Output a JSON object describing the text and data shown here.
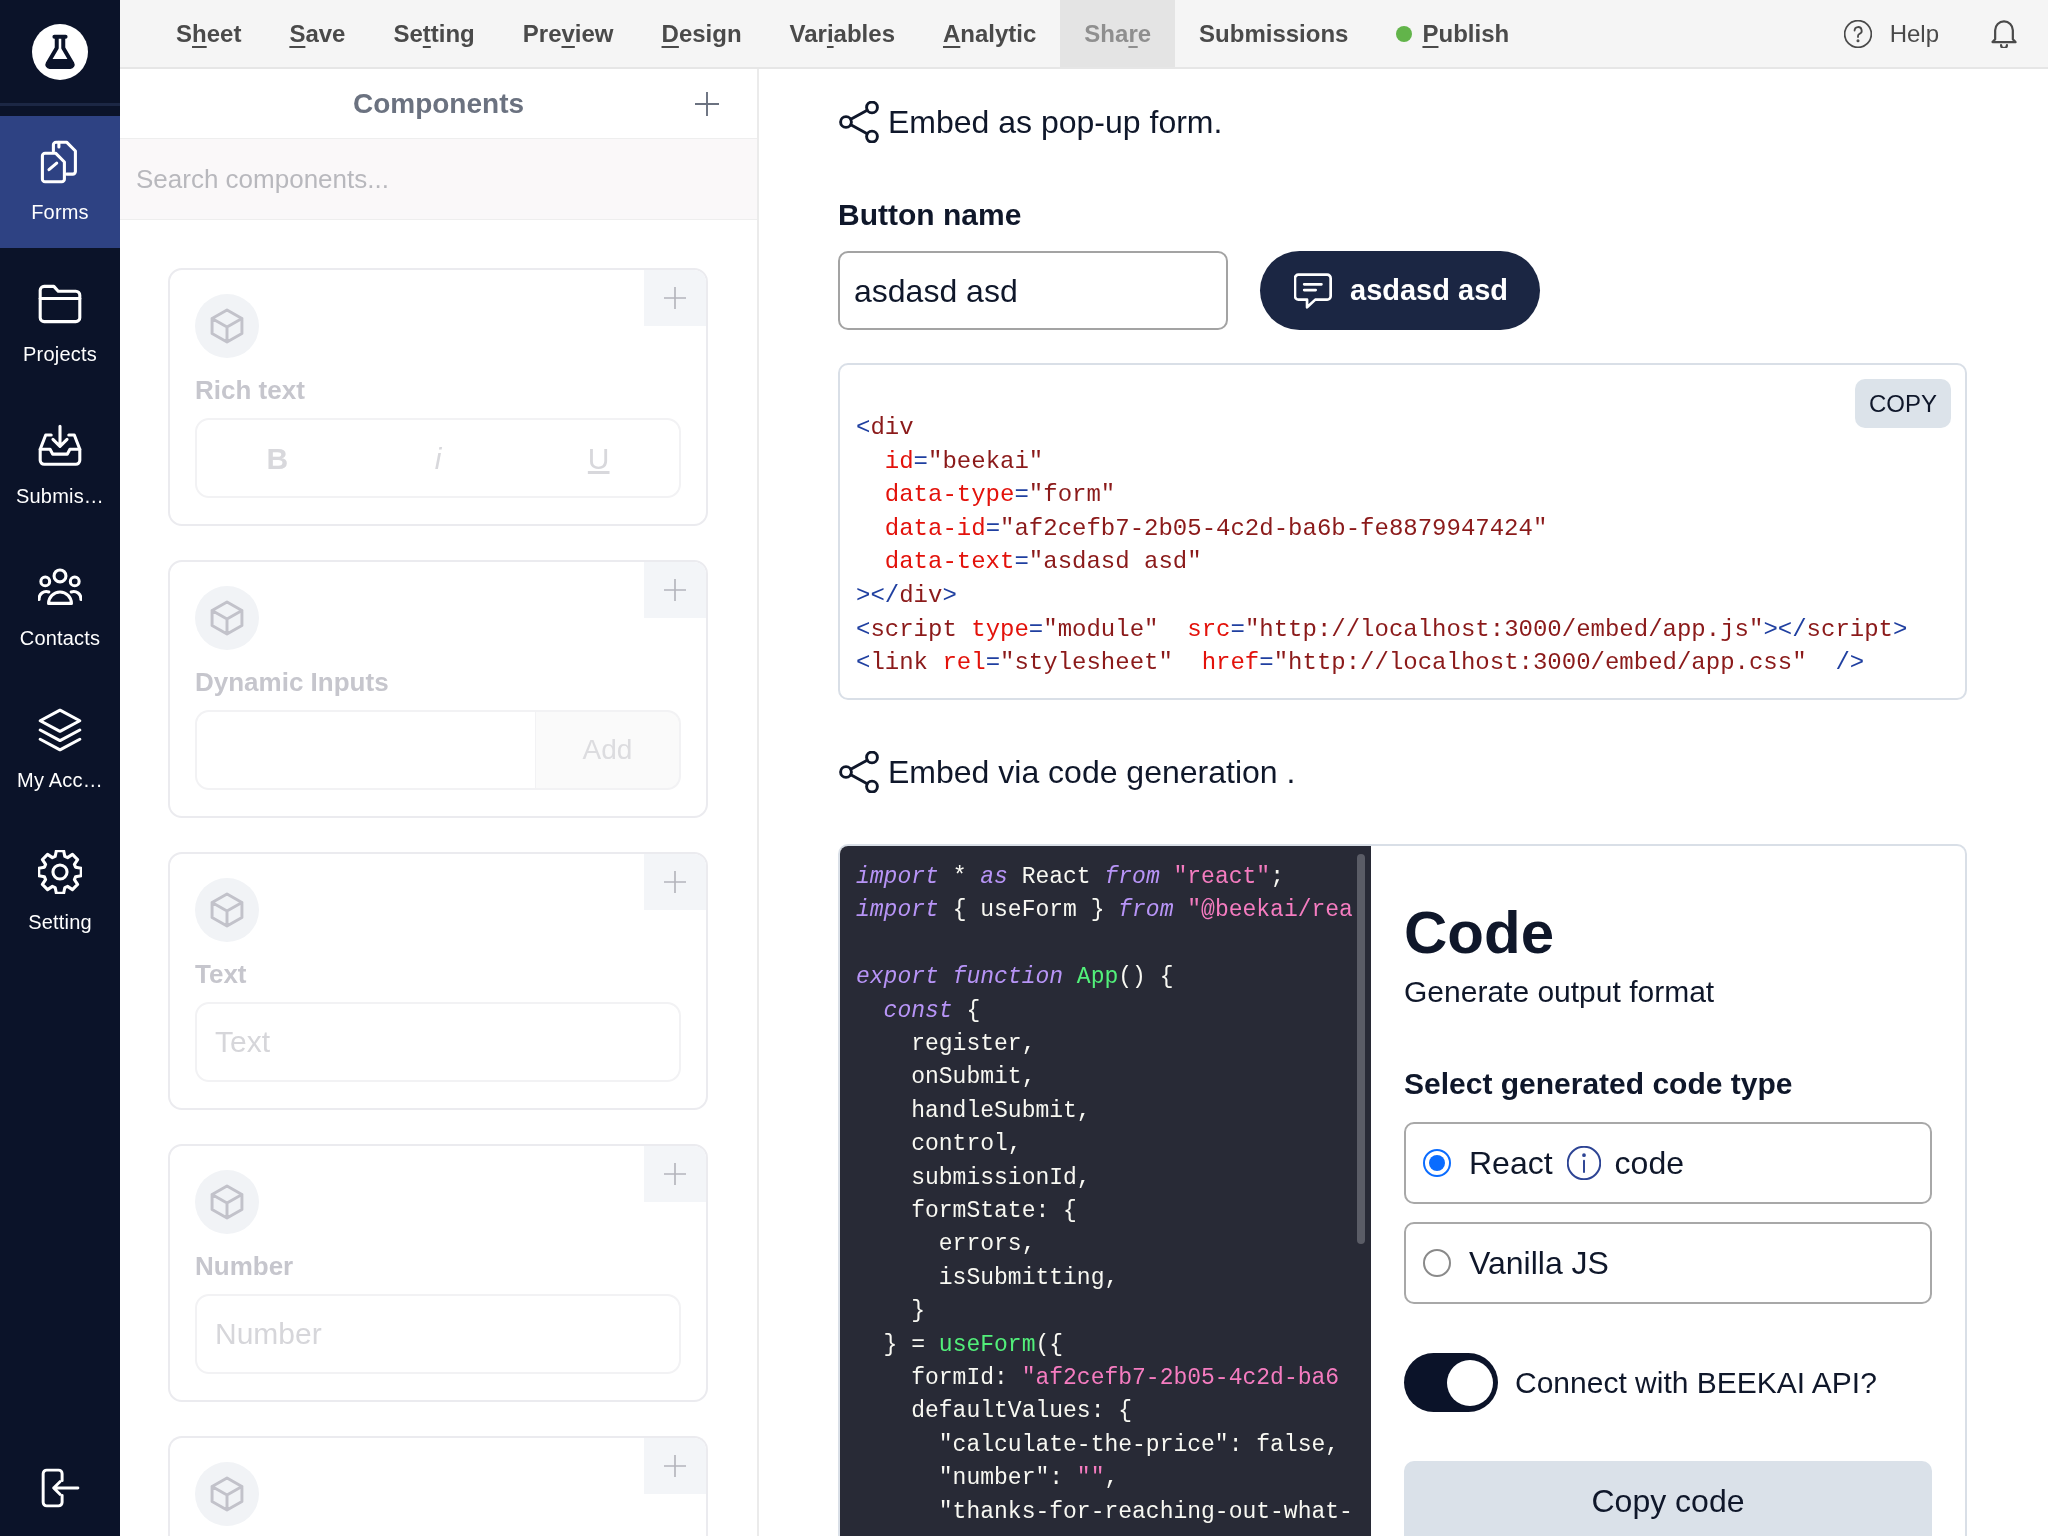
{
  "sidebar": {
    "items": [
      {
        "label": "Forms",
        "selected": true
      },
      {
        "label": "Projects",
        "selected": false
      },
      {
        "label": "Submis…",
        "selected": false
      },
      {
        "label": "Contacts",
        "selected": false
      },
      {
        "label": "My Acc…",
        "selected": false
      },
      {
        "label": "Setting",
        "selected": false
      }
    ]
  },
  "top_nav": {
    "items": [
      {
        "label_start": "S",
        "hotkey": "h",
        "label_end": "eet",
        "kind": "link",
        "selected": false
      },
      {
        "hotkey": "S",
        "label_end": "ave",
        "kind": "link",
        "selected": false
      },
      {
        "label_start": "Se",
        "hotkey": "t",
        "label_end": "ting",
        "kind": "link",
        "selected": false
      },
      {
        "label_start": "Pre",
        "hotkey": "v",
        "label_end": "iew",
        "kind": "link",
        "selected": false
      },
      {
        "hotkey": "D",
        "label_end": "esign",
        "kind": "link",
        "selected": false
      },
      {
        "label_start": "Var",
        "hotkey": "i",
        "label_end": "ables",
        "kind": "link",
        "selected": false
      },
      {
        "hotkey": "A",
        "label_end": "nalytic",
        "kind": "link",
        "selected": false
      },
      {
        "label_start": "Sha",
        "hotkey": "r",
        "label_end": "e",
        "kind": "link",
        "selected": true
      },
      {
        "label_start": "Submissions",
        "kind": "link",
        "selected": false
      },
      {
        "hotkey": "P",
        "label_end": "ublish",
        "kind": "status",
        "selected": false
      }
    ],
    "help": "Help"
  },
  "components_panel": {
    "title": "Components",
    "disabled": true,
    "search": {
      "placeholder": "Search components..."
    },
    "cards": [
      {
        "kind": "richtext",
        "title": "Rich text",
        "buttons": [
          "B",
          "i",
          "U"
        ]
      },
      {
        "kind": "dynamic",
        "title": "Dynamic Inputs",
        "button": "Add"
      },
      {
        "kind": "input",
        "title": "Text",
        "placeholder": "Text"
      },
      {
        "kind": "input",
        "title": "Number",
        "placeholder": "Number"
      },
      {
        "kind": "partial"
      }
    ]
  },
  "popup_embed": {
    "heading": "Embed as pop-up form.",
    "field_label": "Button name",
    "field_value": "asdasd asd",
    "preview_button": "asdasd asd",
    "copy_button": "COPY",
    "code_lines": [
      [
        {
          "kind": "punct",
          "text": "<"
        },
        {
          "kind": "tag",
          "text": "div"
        }
      ],
      [
        {
          "kind": "attr",
          "text": "  id"
        },
        {
          "kind": "punct",
          "text": "="
        },
        {
          "kind": "value",
          "text": "\"beekai\""
        }
      ],
      [
        {
          "kind": "attr",
          "text": "  data-type"
        },
        {
          "kind": "punct",
          "text": "="
        },
        {
          "kind": "value",
          "text": "\"form\""
        }
      ],
      [
        {
          "kind": "attr",
          "text": "  data-id"
        },
        {
          "kind": "punct",
          "text": "="
        },
        {
          "kind": "value",
          "text": "\"af2cefb7-2b05-4c2d-ba6b-fe8879947424\""
        }
      ],
      [
        {
          "kind": "attr",
          "text": "  data-text"
        },
        {
          "kind": "punct",
          "text": "="
        },
        {
          "kind": "value",
          "text": "\"asdasd asd\""
        }
      ],
      [
        {
          "kind": "punct",
          "text": "></"
        },
        {
          "kind": "tag",
          "text": "div"
        },
        {
          "kind": "punct",
          "text": ">"
        }
      ],
      [
        {
          "kind": "punct",
          "text": "<"
        },
        {
          "kind": "tag",
          "text": "script"
        },
        {
          "kind": "attr",
          "text": " type"
        },
        {
          "kind": "punct",
          "text": "="
        },
        {
          "kind": "value",
          "text": "\"module\""
        },
        {
          "kind": "attr",
          "text": "  src"
        },
        {
          "kind": "punct",
          "text": "="
        },
        {
          "kind": "value",
          "text": "\"http://localhost:3000/embed/app.js\""
        },
        {
          "kind": "punct",
          "text": "></"
        },
        {
          "kind": "tag",
          "text": "script"
        },
        {
          "kind": "punct",
          "text": ">"
        }
      ],
      [
        {
          "kind": "punct",
          "text": "<"
        },
        {
          "kind": "tag",
          "text": "link"
        },
        {
          "kind": "attr",
          "text": " rel"
        },
        {
          "kind": "punct",
          "text": "="
        },
        {
          "kind": "value",
          "text": "\"stylesheet\""
        },
        {
          "kind": "attr",
          "text": "  href"
        },
        {
          "kind": "punct",
          "text": "="
        },
        {
          "kind": "value",
          "text": "\"http://localhost:3000/embed/app.css\""
        },
        {
          "kind": "punct",
          "text": "  />"
        }
      ]
    ]
  },
  "code_embed": {
    "heading": "Embed via code generation .",
    "code_blocks": [
      {
        "lines": [
          [
            {
              "kind": "keyword",
              "text": "import"
            },
            {
              "kind": "plain",
              "text": " * "
            },
            {
              "kind": "keyword",
              "text": "as"
            },
            {
              "kind": "plain",
              "text": " React "
            },
            {
              "kind": "keyword",
              "text": "from"
            },
            {
              "kind": "string",
              "text": " \"react\""
            },
            {
              "kind": "plain",
              "text": ";"
            }
          ],
          [
            {
              "kind": "keyword",
              "text": "import"
            },
            {
              "kind": "plain",
              "text": " { useForm } "
            },
            {
              "kind": "keyword",
              "text": "from"
            },
            {
              "kind": "string",
              "text": " \"@beekai/rea"
            }
          ]
        ]
      },
      {
        "lines": [
          [
            {
              "kind": "keyword",
              "text": "export"
            },
            {
              "kind": "keyword",
              "text": " function"
            },
            {
              "kind": "function",
              "text": " App"
            },
            {
              "kind": "plain",
              "text": "() {"
            }
          ],
          [
            {
              "kind": "keyword",
              "text": "  const"
            },
            {
              "kind": "plain",
              "text": " {"
            }
          ],
          [
            {
              "kind": "plain",
              "text": "    register,"
            }
          ],
          [
            {
              "kind": "plain",
              "text": "    onSubmit,"
            }
          ],
          [
            {
              "kind": "plain",
              "text": "    handleSubmit,"
            }
          ],
          [
            {
              "kind": "plain",
              "text": "    control,"
            }
          ],
          [
            {
              "kind": "plain",
              "text": "    submissionId,"
            }
          ],
          [
            {
              "kind": "plain",
              "text": "    formState: {"
            }
          ],
          [
            {
              "kind": "plain",
              "text": "      errors,"
            }
          ],
          [
            {
              "kind": "plain",
              "text": "      isSubmitting,"
            }
          ],
          [
            {
              "kind": "plain",
              "text": "    }"
            }
          ],
          [
            {
              "kind": "plain",
              "text": "  } = "
            },
            {
              "kind": "function",
              "text": "useForm"
            },
            {
              "kind": "plain",
              "text": "({"
            }
          ],
          [
            {
              "kind": "plain",
              "text": "    formId: "
            },
            {
              "kind": "string",
              "text": "\"af2cefb7-2b05-4c2d-ba6"
            }
          ],
          [
            {
              "kind": "plain",
              "text": "    defaultValues: {"
            }
          ],
          [
            {
              "kind": "plain",
              "text": "      \"calculate-the-price\": false,"
            }
          ],
          [
            {
              "kind": "plain",
              "text": "      \"number\": "
            },
            {
              "kind": "string",
              "text": "\"\""
            },
            {
              "kind": "plain",
              "text": ","
            }
          ],
          [
            {
              "kind": "plain",
              "text": "      \"thanks-for-reaching-out-what-"
            }
          ]
        ]
      }
    ],
    "title": "Code",
    "subtitle": "Generate output format",
    "choices_label": "Select generated code type",
    "choices": [
      {
        "label": "React",
        "info": true,
        "suffix": "code",
        "selected": true
      },
      {
        "label": "Vanilla JS",
        "info": false,
        "selected": false
      }
    ],
    "toggle": {
      "label": "Connect with BEEKAI API?",
      "on": true
    },
    "copy_button": "Copy code"
  }
}
